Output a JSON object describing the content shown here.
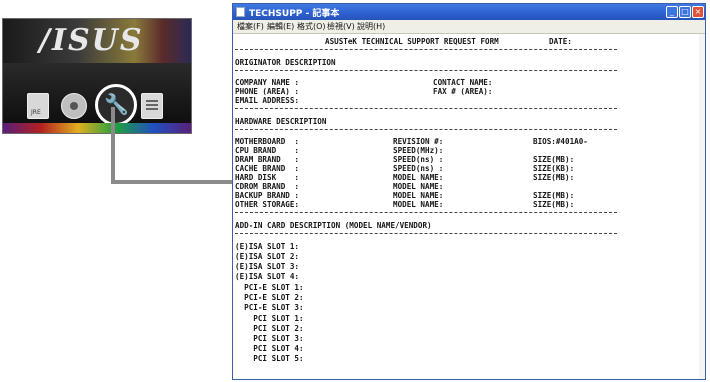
{
  "menu": {
    "logo": "/ISUS",
    "icon_label": "JRE",
    "icons": [
      "jre-icon",
      "disc-icon",
      "wrench-icon",
      "document-icon"
    ]
  },
  "window": {
    "title": "TECHSUPP - 記事本",
    "menu_items": [
      "檔案(F)",
      "編輯(E)",
      "格式(O)",
      "檢視(V)",
      "說明(H)"
    ]
  },
  "form": {
    "header_title": "ASUSTeK TECHNICAL SUPPORT REQUEST FORM",
    "header_date": "DATE:",
    "sec_originator": "ORIGINATOR DESCRIPTION",
    "company": "COMPANY NAME :",
    "contact": "CONTACT NAME:",
    "phone": "PHONE (AREA) :",
    "fax": "FAX # (AREA):",
    "email": "EMAIL ADDRESS:",
    "sec_hardware": "HARDWARE DESCRIPTION",
    "hw_rows": [
      {
        "label": "MOTHERBOARD  :",
        "field": "REVISION #:",
        "extra": "BIOS:#401A0-"
      },
      {
        "label": "CPU BRAND    :",
        "field": "SPEED(MHz):",
        "extra": ""
      },
      {
        "label": "DRAM BRAND   :",
        "field": "SPEED(ns) :",
        "extra": "SIZE(MB):"
      },
      {
        "label": "CACHE BRAND  :",
        "field": "SPEED(ns) :",
        "extra": "SIZE(KB):"
      },
      {
        "label": "HARD DISK    :",
        "field": "MODEL NAME:",
        "extra": "SIZE(MB):"
      },
      {
        "label": "CDROM BRAND  :",
        "field": "MODEL NAME:",
        "extra": ""
      },
      {
        "label": "BACKUP BRAND :",
        "field": "MODEL NAME:",
        "extra": "SIZE(MB):"
      },
      {
        "label": "OTHER STORAGE:",
        "field": "MODEL NAME:",
        "extra": "SIZE(MB):"
      }
    ],
    "sec_addon": "ADD-IN CARD DESCRIPTION (MODEL NAME/VENDOR)",
    "slots": [
      "(E)ISA SLOT 1:",
      "(E)ISA SLOT 2:",
      "(E)ISA SLOT 3:",
      "(E)ISA SLOT 4:",
      "  PCI-E SLOT 1:",
      "  PCI-E SLOT 2:",
      "  PCI-E SLOT 3:",
      "    PCI SLOT 1:",
      "    PCI SLOT 2:",
      "    PCI SLOT 3:",
      "    PCI SLOT 4:",
      "    PCI SLOT 5:"
    ]
  }
}
